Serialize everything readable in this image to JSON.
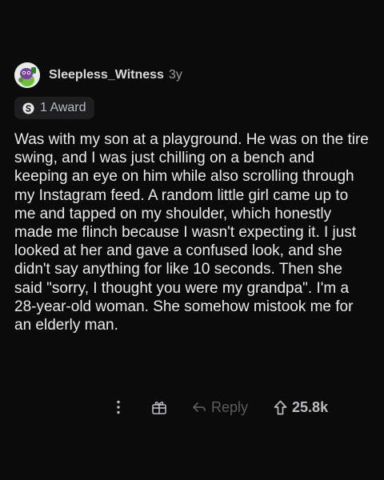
{
  "comment": {
    "author": "Sleepless_Witness",
    "age": "3y",
    "award_label": "1 Award",
    "body": "Was with my son at a playground. He was on the tire swing, and I was just chilling on a bench and keeping an eye on him while also scrolling through my Instagram feed. A random little girl came up to me and tapped on my shoulder, which honestly made me flinch because I wasn't expecting it. I just looked at her and gave a confused look, and she didn't say anything for like 10 seconds. Then she said \"sorry, I thought you were my grandpa\". I'm a 28-year-old woman. She somehow mistook me for an elderly man."
  },
  "actions": {
    "reply_label": "Reply",
    "upvote_count": "25.8k"
  },
  "icons": {
    "avatar": "snoo-avatar",
    "award": "award-icon",
    "more": "more-vertical-icon",
    "gift": "gift-icon",
    "reply": "reply-arrow-icon",
    "upvote": "upvote-arrow-icon"
  },
  "colors": {
    "background": "#0b0b0c",
    "text": "#e8eaec",
    "muted": "#9a9ea2",
    "reply_disabled": "#5a5d61",
    "award_pill": "#1d1e20",
    "avatar_accent": "#7e3fa5"
  }
}
